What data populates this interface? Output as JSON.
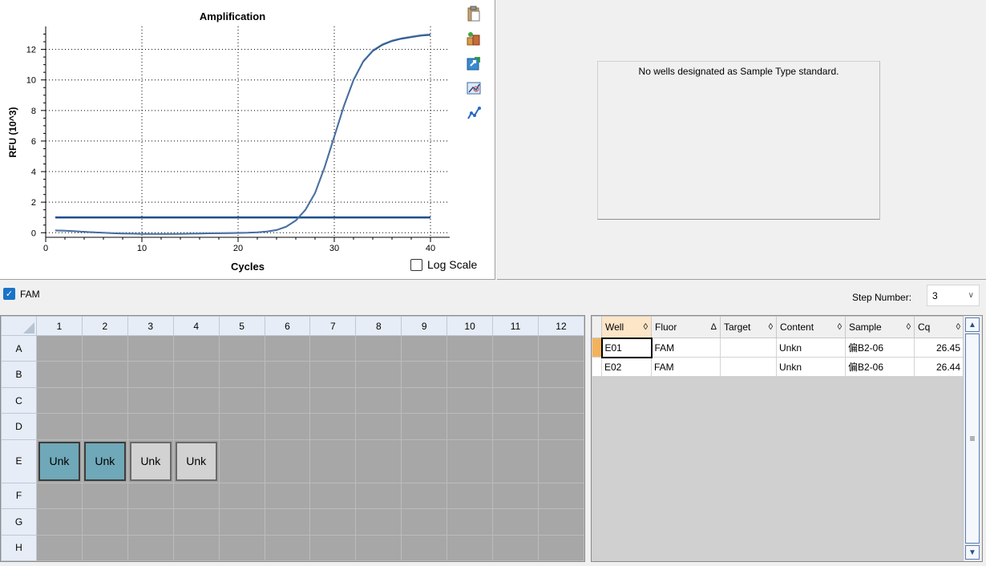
{
  "chart_data": {
    "type": "line",
    "title": "Amplification",
    "xlabel": "Cycles",
    "ylabel": "RFU (10^3)",
    "xlim": [
      0,
      42
    ],
    "ylim": [
      -0.3,
      13.5
    ],
    "xticks": [
      0,
      10,
      20,
      30,
      40
    ],
    "yticks": [
      0,
      2,
      4,
      6,
      8,
      10,
      12
    ],
    "grid": "dotted",
    "threshold": 1.0,
    "series": [
      {
        "color": "#1f4e8c",
        "x": [
          1,
          2,
          3,
          4,
          5,
          6,
          7,
          8,
          9,
          10,
          11,
          12,
          13,
          14,
          15,
          16,
          17,
          18,
          19,
          20,
          21,
          22,
          23,
          24,
          25,
          26,
          27,
          28,
          29,
          30,
          31,
          32,
          33,
          34,
          35,
          36,
          37,
          38,
          39,
          40
        ],
        "y": [
          0.15,
          0.13,
          0.1,
          0.06,
          0.03,
          0.0,
          -0.03,
          -0.05,
          -0.06,
          -0.07,
          -0.08,
          -0.08,
          -0.08,
          -0.07,
          -0.06,
          -0.05,
          -0.04,
          -0.03,
          -0.02,
          -0.01,
          0.0,
          0.03,
          0.08,
          0.18,
          0.4,
          0.8,
          1.5,
          2.6,
          4.3,
          6.3,
          8.3,
          10.0,
          11.2,
          11.9,
          12.3,
          12.55,
          12.7,
          12.8,
          12.9,
          12.95
        ]
      },
      {
        "color": "#5b7fa8",
        "x": [
          1,
          2,
          3,
          4,
          5,
          6,
          7,
          8,
          9,
          10,
          11,
          12,
          13,
          14,
          15,
          16,
          17,
          18,
          19,
          20,
          21,
          22,
          23,
          24,
          25,
          26,
          27,
          28,
          29,
          30,
          31,
          32,
          33,
          34,
          35,
          36,
          37,
          38,
          39,
          40
        ],
        "y": [
          0.17,
          0.14,
          0.11,
          0.07,
          0.04,
          0.01,
          -0.02,
          -0.04,
          -0.05,
          -0.06,
          -0.07,
          -0.07,
          -0.07,
          -0.06,
          -0.05,
          -0.04,
          -0.03,
          -0.02,
          -0.01,
          0.0,
          0.01,
          0.04,
          0.09,
          0.19,
          0.42,
          0.82,
          1.52,
          2.62,
          4.35,
          6.35,
          8.35,
          10.05,
          11.25,
          11.95,
          12.35,
          12.6,
          12.75,
          12.85,
          12.95,
          13.0
        ]
      }
    ]
  },
  "toolbar": {
    "icons": [
      "clipboard-icon",
      "export-icon",
      "share-icon",
      "zoom-icon",
      "chart-options-icon"
    ]
  },
  "log_scale_label": "Log Scale",
  "std_curve": {
    "message": "No wells designated as Sample Type standard."
  },
  "fluor_filter": {
    "label": "FAM",
    "checked": true
  },
  "step": {
    "label": "Step Number:",
    "value": "3"
  },
  "plate": {
    "columns": [
      "1",
      "2",
      "3",
      "4",
      "5",
      "6",
      "7",
      "8",
      "9",
      "10",
      "11",
      "12"
    ],
    "rows": [
      "A",
      "B",
      "C",
      "D",
      "E",
      "F",
      "G",
      "H"
    ],
    "wells": [
      {
        "row": "E",
        "col": "1",
        "text": "Unk",
        "selected": true
      },
      {
        "row": "E",
        "col": "2",
        "text": "Unk",
        "selected": true
      },
      {
        "row": "E",
        "col": "3",
        "text": "Unk",
        "selected": false
      },
      {
        "row": "E",
        "col": "4",
        "text": "Unk",
        "selected": false
      }
    ]
  },
  "results": {
    "headers": [
      {
        "label": "Well",
        "sort": "◊"
      },
      {
        "label": "Fluor",
        "sort": "Δ"
      },
      {
        "label": "Target",
        "sort": "◊"
      },
      {
        "label": "Content",
        "sort": "◊"
      },
      {
        "label": "Sample",
        "sort": "◊"
      },
      {
        "label": "Cq",
        "sort": "◊"
      }
    ],
    "rows": [
      [
        "E01",
        "FAM",
        "",
        "Unkn",
        "偏B2-06",
        "26.45"
      ],
      [
        "E02",
        "FAM",
        "",
        "Unkn",
        "偏B2-06",
        "26.44"
      ]
    ]
  }
}
